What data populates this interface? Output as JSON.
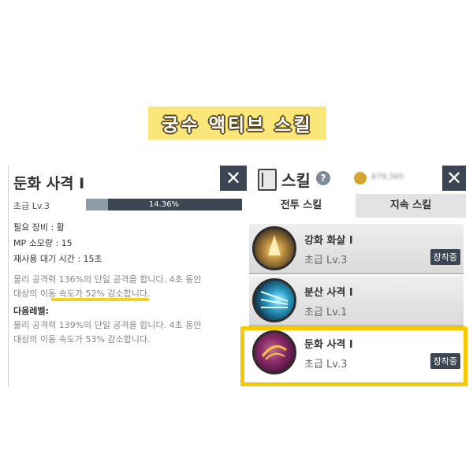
{
  "banner": {
    "title": "궁수 액티브 스킬"
  },
  "detail": {
    "title": "둔화 사격 I",
    "close_label": "✕",
    "grade": "초급 Lv.3",
    "progress_percent": 14.36,
    "progress_text": "14.36%",
    "required_equip": "필요 장비 : 활",
    "mp_cost": "MP 소모량 : 15",
    "cooldown": "재사용 대기 시간 : 15초",
    "desc_line1": "물리 공격력 136%의 단일 공격을 합니다. 4초 동안",
    "desc_line2": "대상의 이동 속도가 52% 감소합니다.",
    "next_level_label": "다음레벨:",
    "next_line1": "물리 공격력 139%의 단일 공격을 합니다. 4초 동안",
    "next_line2": "대상의 이동 속도가 53% 감소합니다."
  },
  "skill_window": {
    "title": "스킬",
    "help_icon": "?",
    "currency_value": "679,365",
    "close_label": "✕",
    "tabs": [
      {
        "label": "전투 스킬",
        "active": true
      },
      {
        "label": "지속 스킬",
        "active": false
      }
    ],
    "skills": [
      {
        "name": "강화 화살 I",
        "grade": "초급 Lv.3",
        "badge": "장착중",
        "icon": "arrow-power-icon"
      },
      {
        "name": "분산 사격 I",
        "grade": "초급 Lv.1",
        "badge": "",
        "icon": "multi-arrow-icon"
      },
      {
        "name": "둔화 사격 I",
        "grade": "초급 Lv.3",
        "badge": "장착중",
        "icon": "slow-shot-icon"
      }
    ]
  },
  "colors": {
    "banner": "#fbe67a",
    "highlight": "#f6c800",
    "dark": "#3c4552"
  }
}
